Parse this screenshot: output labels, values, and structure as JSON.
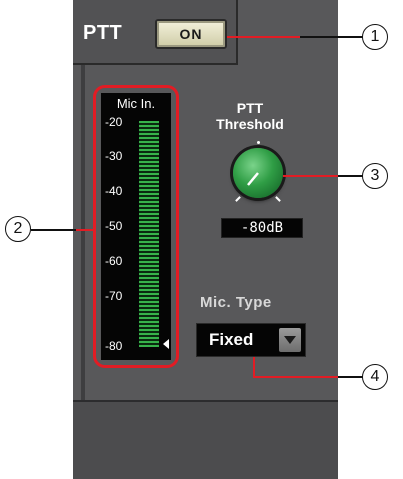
{
  "ptt": {
    "label": "PTT",
    "button_label": "ON"
  },
  "meter": {
    "title": "Mic In.",
    "scale": [
      "-20",
      "-30",
      "-40",
      "-50",
      "-60",
      "-70",
      "-80"
    ]
  },
  "threshold": {
    "title_line1": "PTT",
    "title_line2": "Threshold",
    "value": "-80dB"
  },
  "mic_type": {
    "label": "Mic.  Type",
    "value": "Fixed"
  },
  "callouts": {
    "c1": "1",
    "c2": "2",
    "c3": "3",
    "c4": "4"
  },
  "colors": {
    "panel": "#58585a",
    "highlight": "#e21c24",
    "meter_green": "#37b24a",
    "knob_green": "#2f9d45"
  }
}
